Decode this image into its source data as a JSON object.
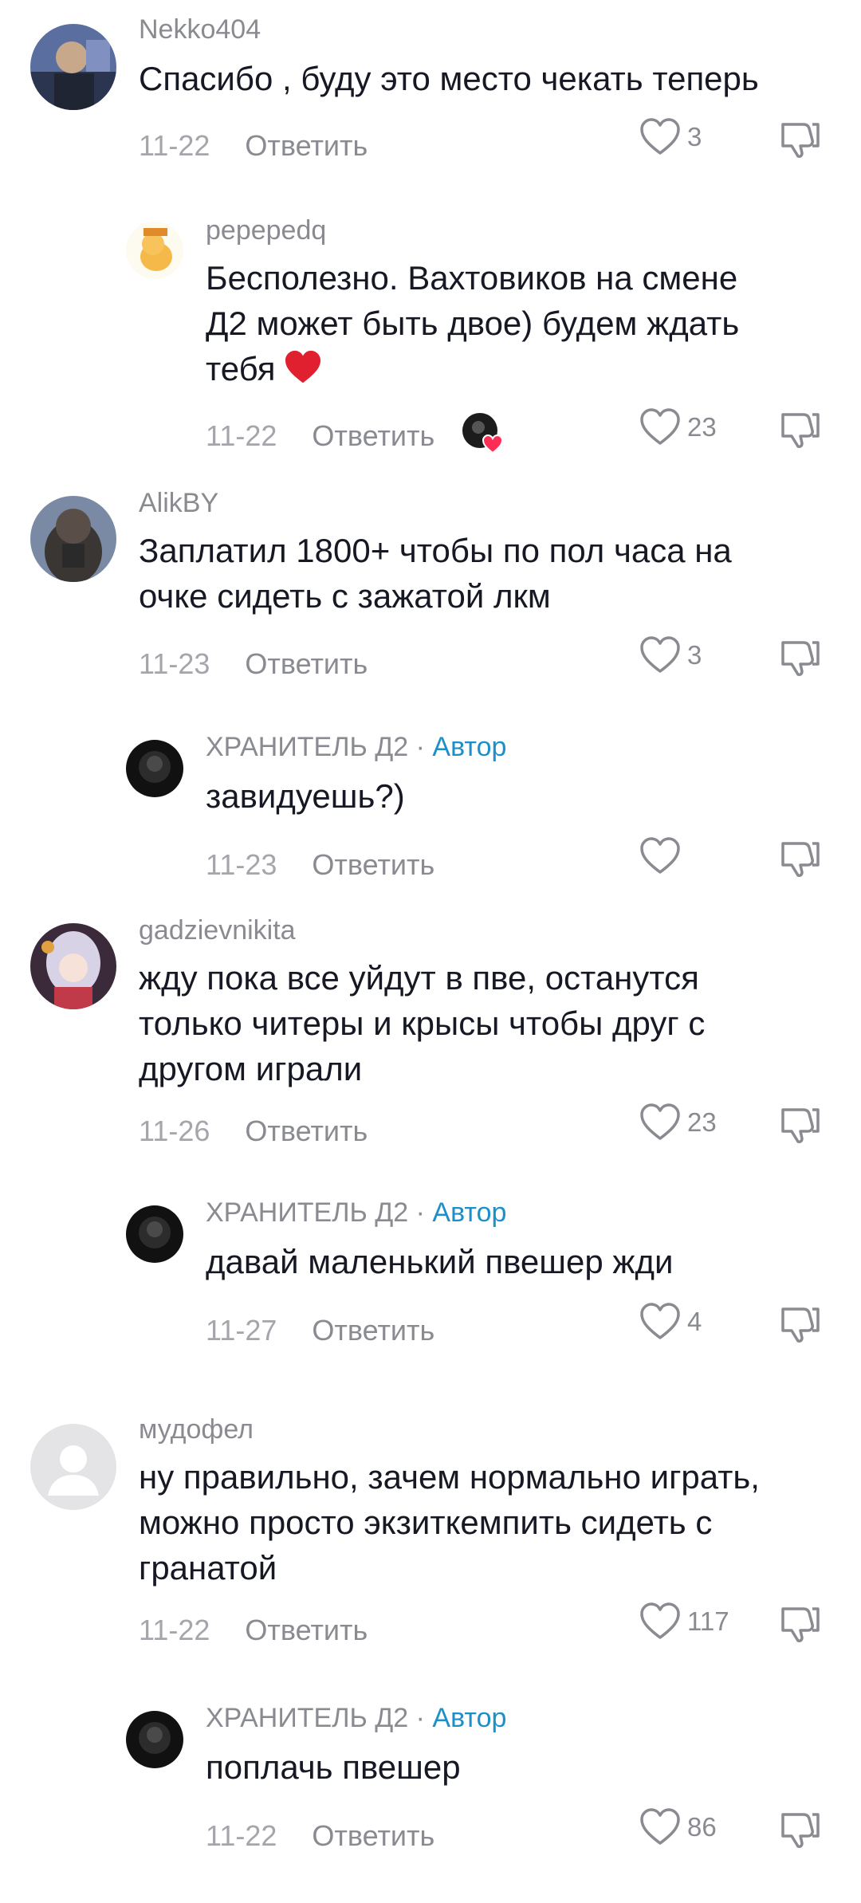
{
  "reply_label": "Ответить",
  "author_label": "Автор",
  "comments": [
    {
      "user": "Nekko404",
      "lines": [
        "Спасибо , буду это место чекать теперь"
      ],
      "date": "11-22",
      "likes": "3"
    },
    {
      "user": "pepepedq",
      "lines": [
        "Бесполезно. Вахтовиков на смене",
        "Д2 может быть двое) будем ждать",
        "тебя"
      ],
      "date": "11-22",
      "likes": "23",
      "emoji": "heart"
    },
    {
      "user": "AlikBY",
      "lines": [
        "Заплатил 1800+ чтобы по пол часа на",
        "очке сидеть с зажатой лкм"
      ],
      "date": "11-23",
      "likes": "3"
    },
    {
      "user": "ХРАНИТЕЛЬ Д2",
      "author_sep": " · ",
      "lines": [
        "завидуешь?)"
      ],
      "date": "11-23",
      "likes": ""
    },
    {
      "user": "gadzievnikita",
      "lines": [
        "жду пока все уйдут в пве, останутся",
        "только читеры и крысы чтобы друг с",
        "другом играли"
      ],
      "date": "11-26",
      "likes": "23"
    },
    {
      "user": "ХРАНИТЕЛЬ Д2",
      "author_sep": " · ",
      "lines": [
        "давай маленький пвешер жди"
      ],
      "date": "11-27",
      "likes": "4"
    },
    {
      "user": "мудофел",
      "lines": [
        "ну правильно, зачем нормально играть,",
        "можно просто экзиткемпить сидеть с",
        "гранатой"
      ],
      "date": "11-22",
      "likes": "117"
    },
    {
      "user": "ХРАНИТЕЛЬ Д2",
      "author_sep": " · ",
      "lines": [
        "поплачь пвешер"
      ],
      "date": "11-22",
      "likes": "86"
    }
  ],
  "icons": {
    "like": "heart-outline-icon",
    "dislike": "thumbs-down-icon",
    "emoji": "red-heart-emoji"
  },
  "colors": {
    "text": "#161823",
    "muted": "#8a8b91",
    "author": "#1e90c9",
    "emoji_heart": "#e0202e"
  }
}
